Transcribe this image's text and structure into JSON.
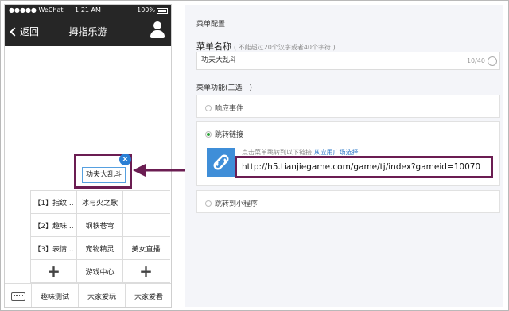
{
  "phone": {
    "status": {
      "carrier": "●●●●● WeChat",
      "time": "1:21 AM",
      "battery": "100%"
    },
    "nav": {
      "back_label": "返回",
      "title": "拇指乐游"
    },
    "menu_rows": [
      [
        "【1】指纹...",
        "冰与火之歌",
        ""
      ],
      [
        "【2】趣味...",
        "钢铁苍穹",
        ""
      ],
      [
        "【3】表情...",
        "宠物精灵",
        "美女直播"
      ],
      [
        "+",
        "游戏中心",
        "+"
      ]
    ],
    "bottom_menu": [
      "趣味测试",
      "大家爱玩",
      "大家爱看"
    ],
    "popup_label": "功夫大乱斗",
    "popup_close": "×"
  },
  "panel": {
    "section_title": "菜单配置",
    "name_label": "菜单名称",
    "name_hint": "( 不能超过20个汉字或者40个字符 )",
    "name_value": "功夫大乱斗",
    "name_count": "10/40",
    "func_label": "菜单功能(三选一)",
    "options": {
      "event": "响应事件",
      "link": "跳转链接",
      "miniapp": "跳转到小程序"
    },
    "link_hint": "点击菜单跳转到以下链接",
    "link_pick": "从应用广场选择",
    "url": "http://h5.tianjiegame.com/game/tj/index?gameid=10070"
  },
  "colors": {
    "highlight": "#6b1d52",
    "link_blue": "#3f8ed8",
    "radio_on": "#2fa43a",
    "navbar": "#262626"
  }
}
